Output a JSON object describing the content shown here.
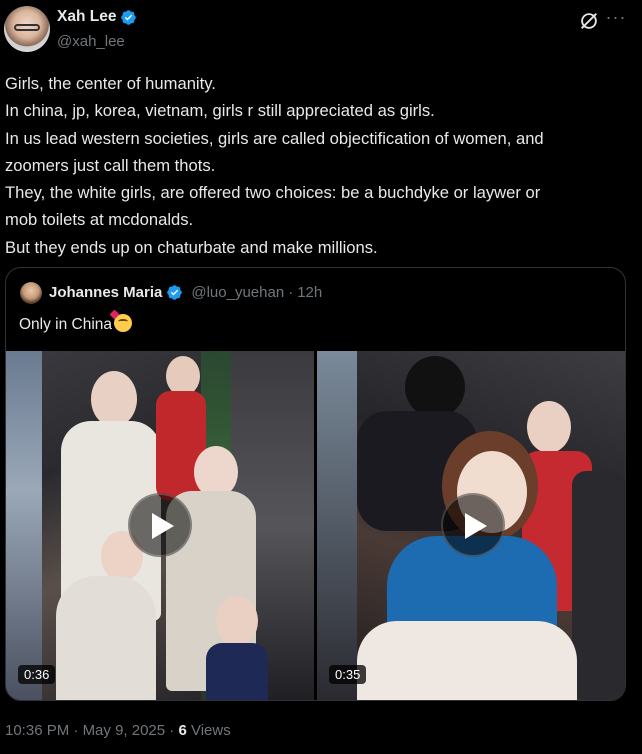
{
  "author": {
    "name": "Xah Lee",
    "handle": "@xah_lee",
    "verified_icon": "verified-badge-icon"
  },
  "actions": {
    "grok_icon": "grok-icon",
    "more_label": "···"
  },
  "post": {
    "lines": [
      "Girls, the center of humanity.",
      "In china, jp, korea, vietnam, girls r still appreciated as girls.",
      "In us lead western societies, girls are called objectification of women, and",
      "zoomers just call them thots.",
      "They, the white girls, are offered two choices: be a buchdyke or laywer or",
      "mob toilets at mcdonalds.",
      "But they ends up on chaturbate and make millions."
    ]
  },
  "quote": {
    "name": "Johannes Maria",
    "handle": "@luo_yuehan",
    "separator": "·",
    "time": "12h",
    "text": "Only in China",
    "emoji": "smiling-face-with-hearts-emoji",
    "videos": [
      {
        "duration": "0:36"
      },
      {
        "duration": "0:35"
      }
    ]
  },
  "meta": {
    "time": "10:36 PM",
    "sep1": "·",
    "date": "May 9, 2025",
    "sep2": "·",
    "views_count": "6",
    "views_label": "Views"
  },
  "colors": {
    "background": "#000000",
    "text": "#e7e9ea",
    "muted": "#71767b",
    "verified": "#1d9bf0",
    "border": "#2f3336"
  }
}
